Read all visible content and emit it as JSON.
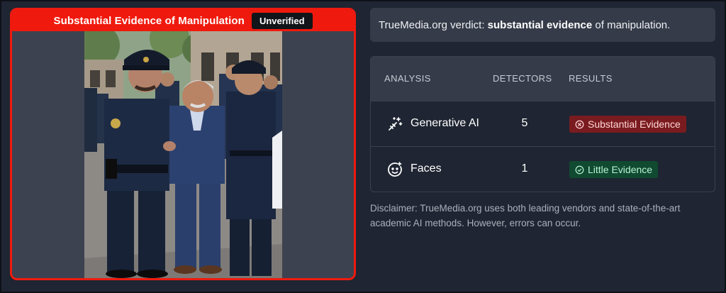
{
  "media": {
    "verdict_title": "Substantial Evidence of Manipulation",
    "status_badge": "Unverified",
    "accent_color": "#f0190d"
  },
  "verdict": {
    "prefix": "TrueMedia.org verdict: ",
    "emphasis": "substantial evidence",
    "suffix": " of manipulation."
  },
  "analysis": {
    "columns": [
      "ANALYSIS",
      "DETECTORS",
      "RESULTS"
    ],
    "rows": [
      {
        "icon": "sparkles-icon",
        "name": "Generative AI",
        "detectors": "5",
        "result": "Substantial Evidence",
        "result_icon": "x-circle-icon",
        "result_color": "#7a1b1f"
      },
      {
        "icon": "face-icon",
        "name": "Faces",
        "detectors": "1",
        "result": "Little Evidence",
        "result_icon": "check-circle-icon",
        "result_color": "#0f4a31"
      }
    ]
  },
  "disclaimer": "Disclaimer: TrueMedia.org uses both leading vendors and state-of-the-art academic AI methods. However, errors can occur."
}
